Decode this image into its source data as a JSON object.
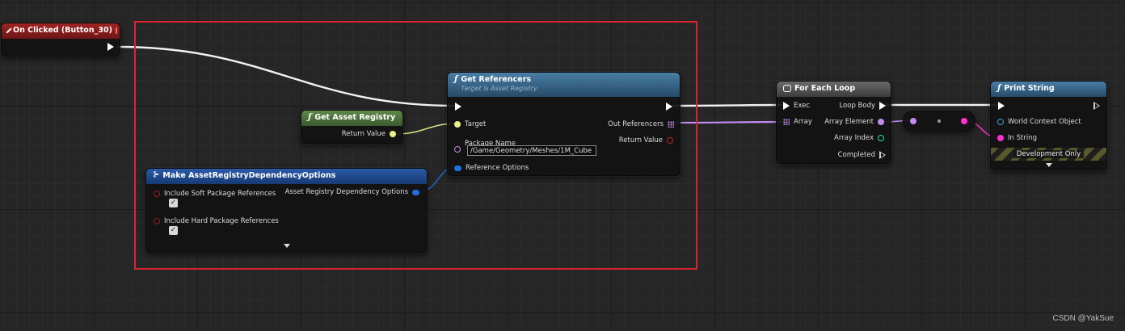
{
  "nodes": {
    "on_clicked": {
      "title": "On Clicked (Button_30)"
    },
    "get_asset_registry": {
      "title": "Get Asset Registry",
      "return_value": "Return Value"
    },
    "make_options": {
      "title": "Make AssetRegistryDependencyOptions",
      "soft": "Include Soft Package References",
      "hard": "Include Hard Package References",
      "output": "Asset Registry Dependency Options",
      "soft_checked": true,
      "hard_checked": true
    },
    "get_referencers": {
      "title": "Get Referencers",
      "subtitle": "Target is Asset Registry",
      "target": "Target",
      "package_name": "Package Name",
      "package_value": "/Game/Geometry/Meshes/1M_Cube",
      "reference_options": "Reference Options",
      "out_referencers": "Out Referencers",
      "return_value": "Return Value"
    },
    "for_each": {
      "title": "For Each Loop",
      "exec": "Exec",
      "array": "Array",
      "loop_body": "Loop Body",
      "array_element": "Array Element",
      "array_index": "Array Index",
      "completed": "Completed"
    },
    "print_string": {
      "title": "Print String",
      "world_context": "World Context Object",
      "in_string": "In String",
      "development_only": "Development Only"
    }
  },
  "watermark": "CSDN @YakSue",
  "colors": {
    "event_header": "#8f1d1d",
    "pure_header": "#4f7a3e",
    "function_header": "#3c6a8e",
    "struct_header": "#1f4a8c",
    "macro_header": "#5a5a5a",
    "exec": "#ffffff",
    "object_pin": "#e9f08c",
    "struct_pin": "#1e6fe0",
    "string_pin": "#ff2fd0",
    "name_pin": "#c38cf0",
    "bool_pin": "#9b1b1b",
    "int_pin": "#1fe0a6",
    "wildcard_pin": "#b867e6",
    "selection": "#d8262e"
  },
  "icons": [
    "event-diamond-icon",
    "function-icon",
    "struct-make-icon",
    "loop-macro-icon",
    "exec-pin-icon",
    "checkbox-icon",
    "expand-arrow-icon"
  ]
}
